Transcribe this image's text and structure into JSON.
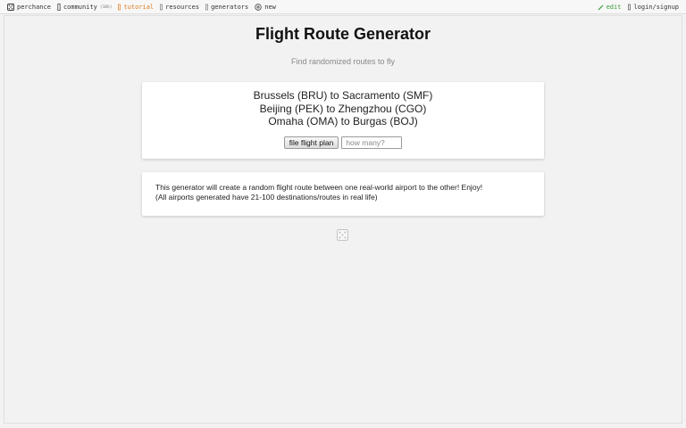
{
  "nav": {
    "left": [
      {
        "icon": "dice-icon",
        "label": "perchance"
      },
      {
        "icon": "community-icon",
        "label": "community",
        "badge": "(18h)"
      },
      {
        "icon": "tutorial-icon",
        "label": "tutorial"
      },
      {
        "icon": "resources-icon",
        "label": "resources"
      },
      {
        "icon": "generators-icon",
        "label": "generators"
      },
      {
        "icon": "plus-icon",
        "label": "new"
      }
    ],
    "right": [
      {
        "icon": "pencil-icon",
        "label": "edit"
      },
      {
        "icon": "user-icon",
        "label": "login/signup"
      }
    ]
  },
  "colors": {
    "tutorial": "#e07a1f",
    "edit": "#3a9a3a",
    "background": "#f2f2f2",
    "card": "#ffffff"
  },
  "page": {
    "title": "Flight Route Generator",
    "subtitle": "Find randomized routes to fly"
  },
  "output": {
    "routes": [
      "Brussels (BRU) to Sacramento (SMF)",
      "Beijing (PEK) to Zhengzhou (CGO)",
      "Omaha (OMA) to Burgas (BOJ)"
    ],
    "button_label": "file flight plan",
    "count_placeholder": "how many?",
    "count_value": ""
  },
  "info": {
    "line1": "This generator will create a random flight route between one real-world airport to the other! Enjoy!",
    "line2": "(All airports generated have 21-100 destinations/routes in real life)"
  },
  "footer": {
    "icon": "dice-icon"
  }
}
